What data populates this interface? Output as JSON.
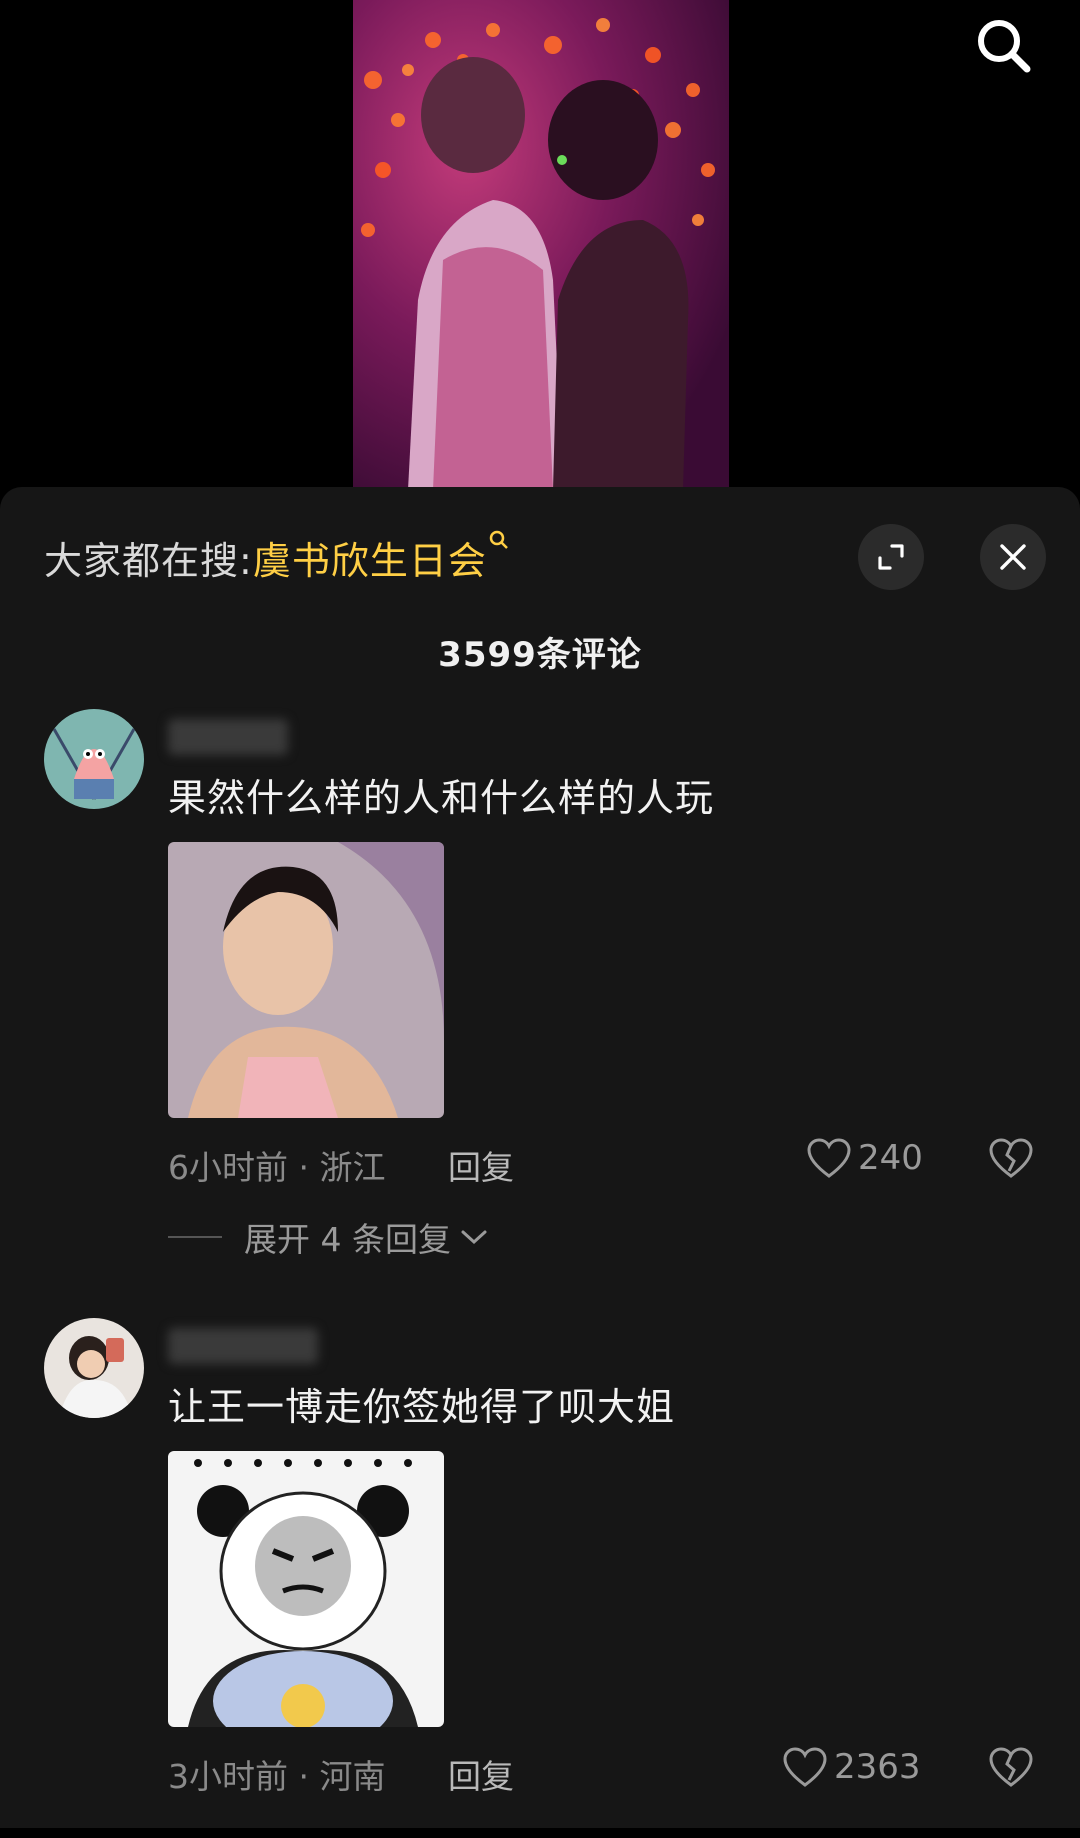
{
  "hot_search": {
    "prefix": "大家都在搜:",
    "term": "虞书欣生日会",
    "icon": "search-icon"
  },
  "controls": {
    "top_search_icon": "search-icon",
    "expand_icon": "expand-icon",
    "close_icon": "close-icon"
  },
  "comments_header": {
    "count_label": "3599条评论"
  },
  "comments": [
    {
      "text": "果然什么样的人和什么样的人玩",
      "time_location": "6小时前 · 浙江",
      "reply_label": "回复",
      "likes": "240",
      "expand_replies": "展开 4 条回复"
    },
    {
      "text": "让王一博走你签她得了呗大姐",
      "time_location": "3小时前 · 河南",
      "reply_label": "回复",
      "likes": "2363"
    }
  ],
  "colors": {
    "accent": "#ffcf45",
    "sheet_bg": "#161616",
    "button_bg": "#2b2b2b"
  }
}
